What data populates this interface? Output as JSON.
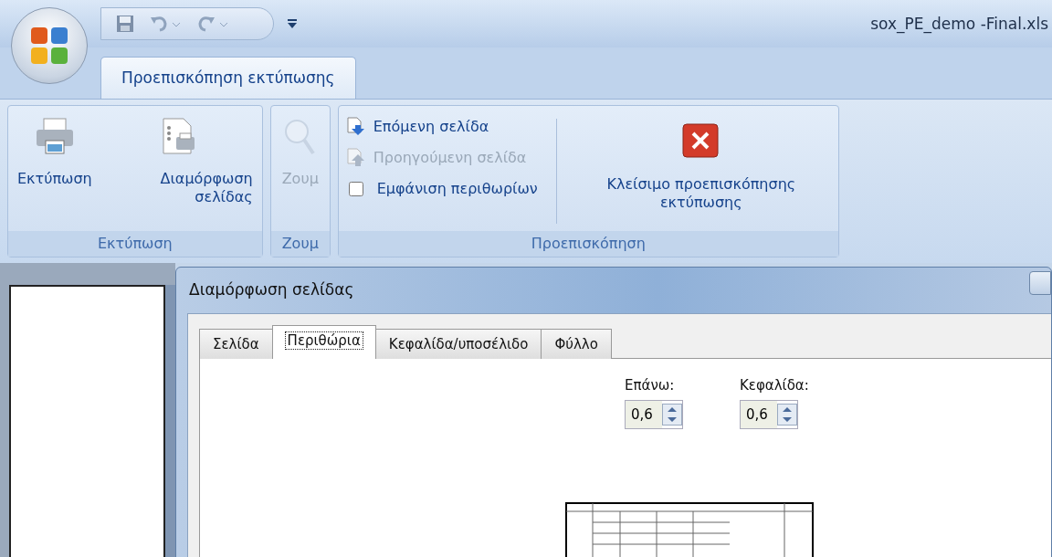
{
  "window": {
    "title": "sox_PE_demo -Final.xls"
  },
  "ribbon_tabs": [
    {
      "label": "Προεπισκόπηση εκτύπωσης",
      "selected": true
    }
  ],
  "ribbon_groups": [
    {
      "label": "Εκτύπωση",
      "items": [
        {
          "kind": "large",
          "label": "Εκτύπωση",
          "disabled": false
        },
        {
          "kind": "large",
          "label": "Διαμόρφωση σελίδας",
          "disabled": false
        }
      ]
    },
    {
      "label": "Ζουμ",
      "items": [
        {
          "kind": "large",
          "label": "Ζουμ",
          "disabled": true
        }
      ]
    },
    {
      "label": "Προεπισκόπηση",
      "items": [
        {
          "kind": "small",
          "label": "Επόμενη σελίδα",
          "disabled": false
        },
        {
          "kind": "small",
          "label": "Προηγούμενη σελίδα",
          "disabled": true
        },
        {
          "kind": "checkbox",
          "label": "Εμφάνιση περιθωρίων",
          "checked": false
        },
        {
          "kind": "large",
          "label": "Κλείσιμο προεπισκόπησης εκτύπωσης",
          "disabled": false
        }
      ]
    }
  ],
  "dialog": {
    "title": "Διαμόρφωση σελίδας",
    "tabs": [
      {
        "label": "Σελίδα",
        "selected": false
      },
      {
        "label": "Περιθώρια",
        "selected": true
      },
      {
        "label": "Κεφαλίδα/υποσέλιδο",
        "selected": false
      },
      {
        "label": "Φύλλο",
        "selected": false
      }
    ],
    "fields": [
      {
        "label": "Επάνω:",
        "value": "0,6"
      },
      {
        "label": "Κεφαλίδα:",
        "value": "0,6"
      }
    ]
  }
}
